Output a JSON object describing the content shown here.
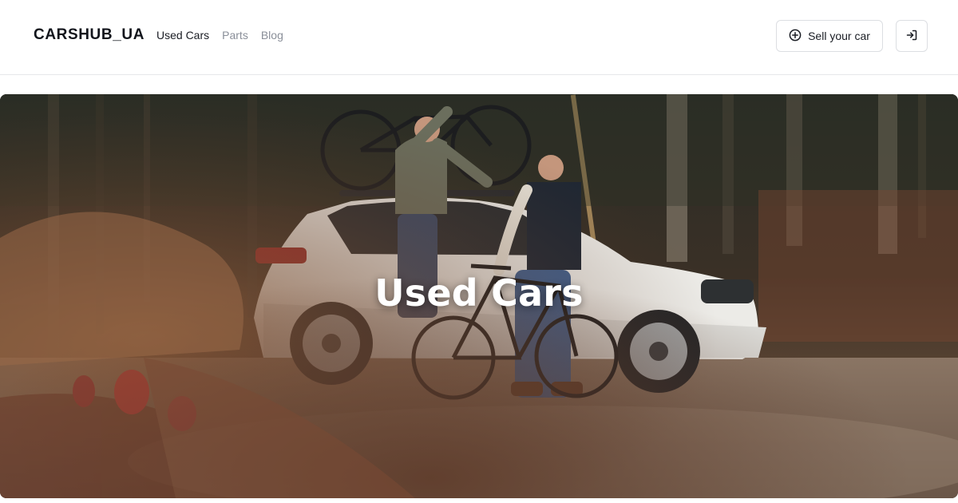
{
  "header": {
    "brand": "CARSHUB_UA",
    "nav": [
      {
        "label": "Used Cars",
        "active": true
      },
      {
        "label": "Parts",
        "active": false
      },
      {
        "label": "Blog",
        "active": false
      }
    ],
    "sell_button": {
      "label": "Sell your car",
      "icon": "plus-circle-icon"
    },
    "login_button": {
      "icon": "login-icon"
    }
  },
  "hero": {
    "title": "Used Cars",
    "image": "photo-white-suv-forest-cyclists"
  },
  "colors": {
    "text": "#1a1d24",
    "muted": "#8a8f99",
    "border": "#dcdee2",
    "hero_title": "#ffffff"
  }
}
